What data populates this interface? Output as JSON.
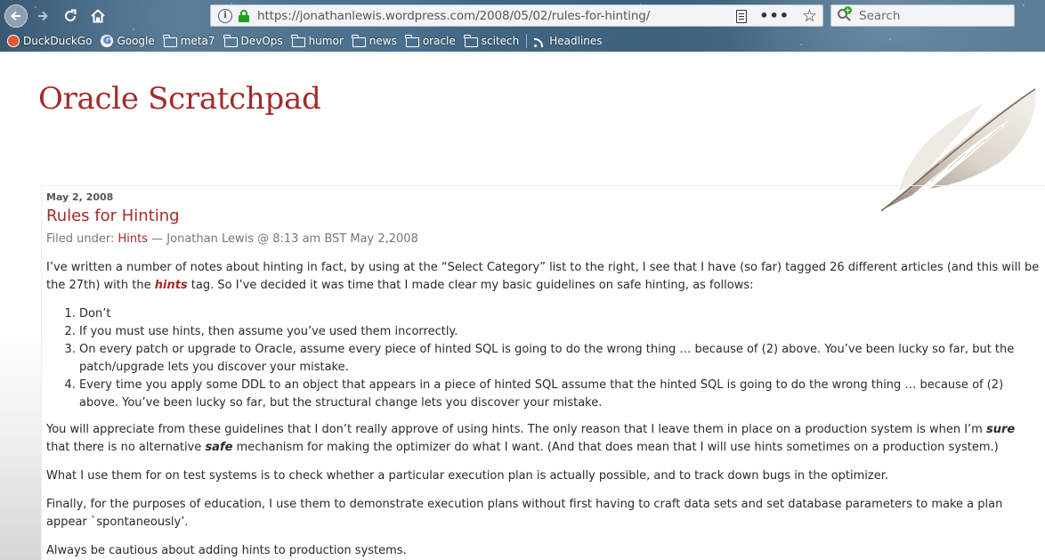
{
  "browser": {
    "url": "https://jonathanlewis.wordpress.com/2008/05/02/rules-for-hinting/",
    "search_placeholder": "Search",
    "bookmarks": [
      {
        "label": "DuckDuckGo",
        "icon": "duckduckgo-icon"
      },
      {
        "label": "Google",
        "icon": "google-icon"
      },
      {
        "label": "meta7",
        "icon": "folder-icon"
      },
      {
        "label": "DevOps",
        "icon": "folder-icon"
      },
      {
        "label": "humor",
        "icon": "folder-icon"
      },
      {
        "label": "news",
        "icon": "folder-icon"
      },
      {
        "label": "oracle",
        "icon": "folder-icon"
      },
      {
        "label": "scitech",
        "icon": "folder-icon"
      },
      {
        "label": "Headlines",
        "icon": "rss-icon"
      }
    ]
  },
  "site": {
    "title": "Oracle Scratchpad",
    "accent_color": "#a52a2a"
  },
  "post": {
    "date": "May 2, 2008",
    "title": "Rules for Hinting",
    "meta_prefix": "Filed under:",
    "category": "Hints",
    "meta_suffix": "— Jonathan Lewis @ 8:13 am BST May 2,2008",
    "intro_before": "I’ve written a number of notes about hinting in fact, by using at the “Select Category” list to the right, I see that I have (so far) tagged 26 different articles (and this will be the 27th) with the ",
    "intro_tag": "hints",
    "intro_after": " tag. So I’ve decided it was time that I made clear my basic guidelines on safe hinting, as follows:",
    "rules": [
      "Don’t",
      "If you must use hints, then assume you’ve used them incorrectly.",
      "On every patch or upgrade to Oracle, assume every piece of hinted SQL is going to do the wrong thing … because of (2) above. You’ve been lucky so far, but the patch/upgrade lets you discover your mistake.",
      "Every time you apply some DDL to an object that appears in a piece of hinted SQL assume that the hinted SQL is going to do the wrong thing … because of (2) above. You’ve been lucky so far, but the structural change lets you discover your mistake."
    ],
    "p2_a": "You will appreciate from these guidelines that I don’t really approve of using hints. The only reason that I leave them in place on a production system is when I’m ",
    "p2_sure": "sure",
    "p2_b": " that there is no alternative ",
    "p2_safe": "safe",
    "p2_c": " mechanism for making the optimizer do what I want. (And that does mean that I will use hints sometimes on a production system.)",
    "p3": "What I use them for on test systems is to check whether a particular execution plan is actually possible, and to track down bugs in the optimizer.",
    "p4": "Finally, for the purposes of education, I use them to demonstrate execution plans without first having to craft data sets and set database parameters to make a plan appear `spontaneously’.",
    "p5": "Always be cautious about adding hints to production systems."
  }
}
